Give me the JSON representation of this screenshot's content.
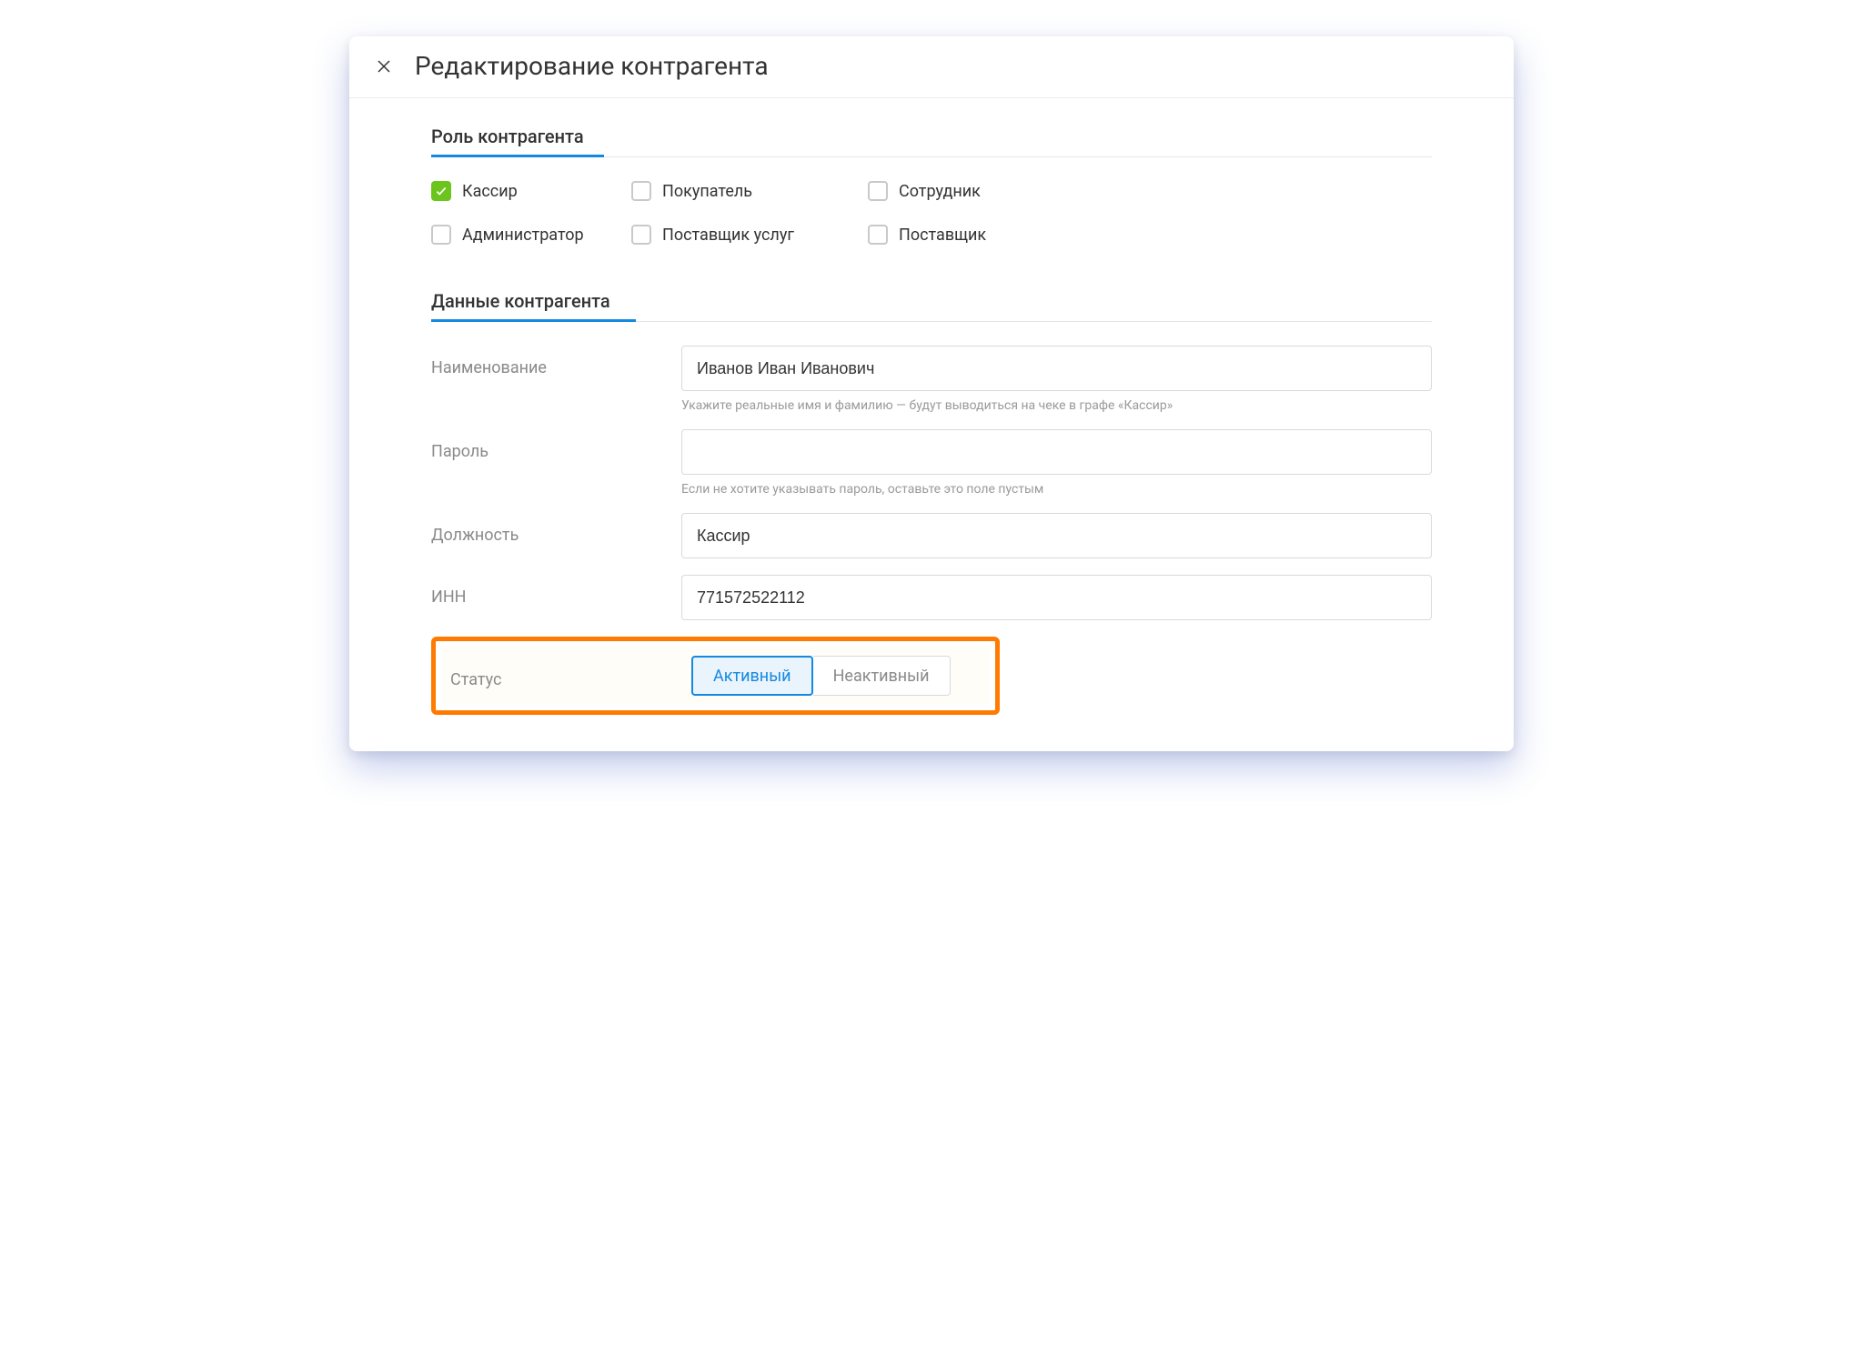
{
  "header": {
    "title": "Редактирование контрагента"
  },
  "sections": {
    "role_title": "Роль контрагента",
    "data_title": "Данные контрагента"
  },
  "roles": {
    "cashier": {
      "label": "Кассир",
      "checked": true
    },
    "buyer": {
      "label": "Покупатель",
      "checked": false
    },
    "employee": {
      "label": "Сотрудник",
      "checked": false
    },
    "admin": {
      "label": "Администратор",
      "checked": false
    },
    "svc_prov": {
      "label": "Поставщик услуг",
      "checked": false
    },
    "supplier": {
      "label": "Поставщик",
      "checked": false
    }
  },
  "fields": {
    "name": {
      "label": "Наименование",
      "value": "Иванов Иван Иванович",
      "hint": "Укажите реальные имя и фамилию — будут выводиться на чеке в графе «Кассир»"
    },
    "password": {
      "label": "Пароль",
      "value": "",
      "hint": "Если не хотите указывать пароль, оставьте это поле пустым"
    },
    "position": {
      "label": "Должность",
      "value": "Кассир"
    },
    "inn": {
      "label": "ИНН",
      "value": "771572522112"
    },
    "status": {
      "label": "Статус",
      "active_label": "Активный",
      "inactive_label": "Неактивный",
      "value": "active"
    }
  }
}
